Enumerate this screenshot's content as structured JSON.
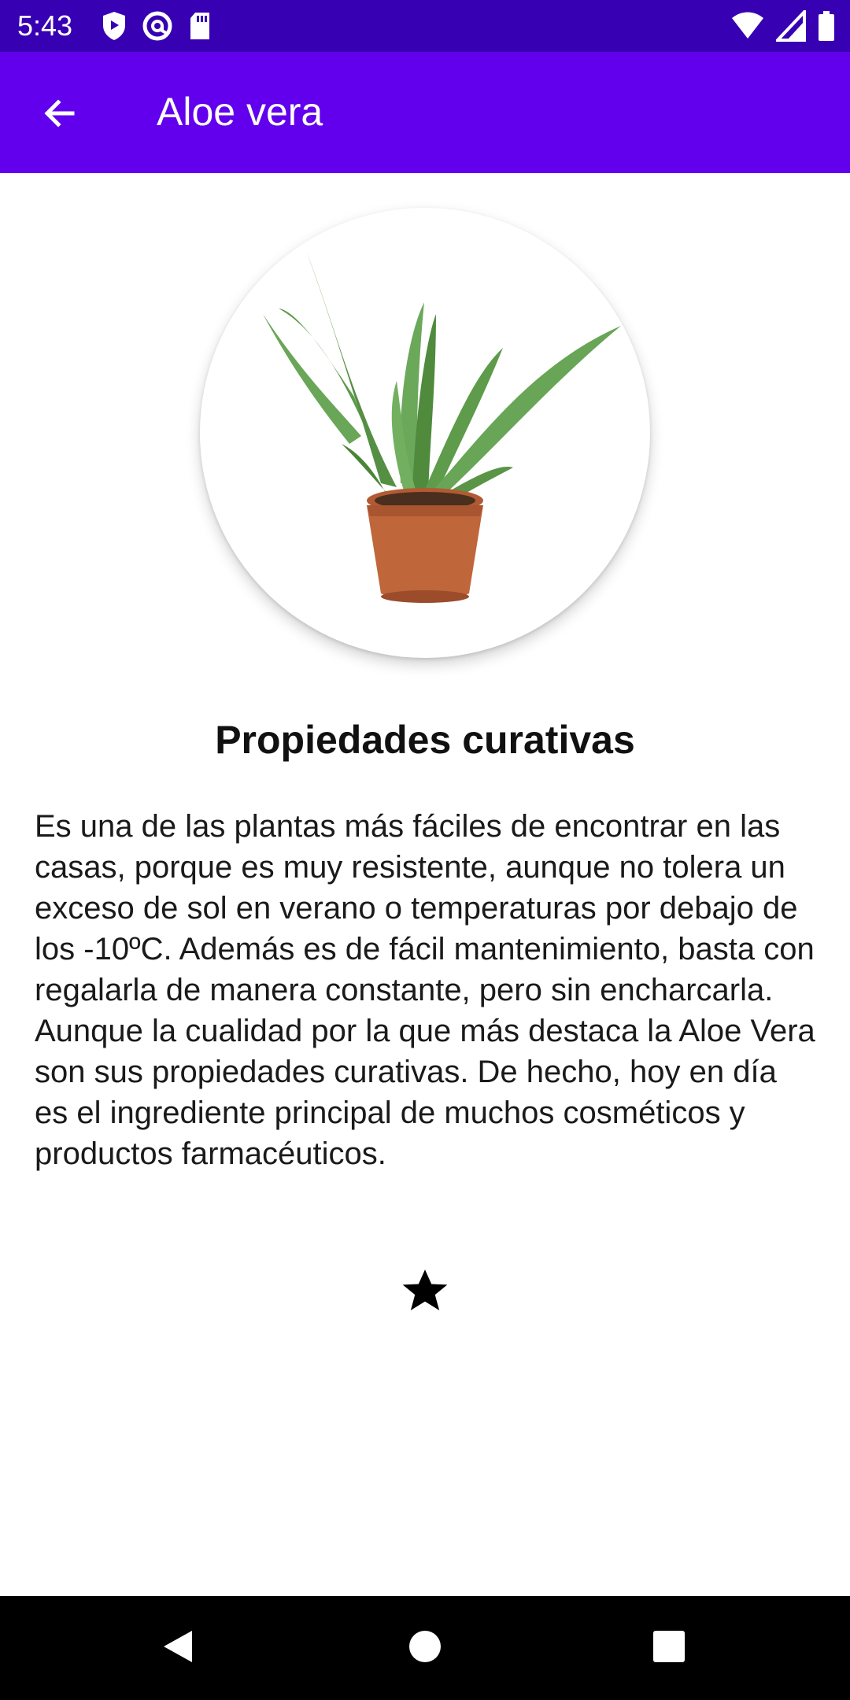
{
  "status_bar": {
    "time": "5:43",
    "left_icons": [
      "shield-icon",
      "at-sign-icon",
      "sd-card-icon"
    ],
    "right_icons": [
      "wifi-icon",
      "cell-signal-icon",
      "battery-icon"
    ]
  },
  "app_bar": {
    "title": "Aloe vera",
    "back_icon": "arrow-back-icon",
    "background": "#6200ee"
  },
  "plant_image": {
    "subject": "aloe vera plant in terracotta pot"
  },
  "content": {
    "section_title": "Propiedades curativas",
    "description": "Es una de las plantas más fáciles de encontrar en las casas, porque es muy resistente, aunque no tolera un exceso de sol en verano o temperaturas por debajo de los -10ºC. Además es de fácil mantenimiento, basta con regalarla de manera constante, pero sin encharcarla. Aunque la cualidad por la que más destaca la Aloe Vera son sus propiedades curativas. De hecho, hoy en día es el ingrediente principal de muchos cosméticos y productos farmacéuticos.",
    "favorite_icon": "star-icon"
  },
  "nav_bar": {
    "buttons": [
      "back-triangle-icon",
      "home-circle-icon",
      "recents-square-icon"
    ]
  },
  "colors": {
    "status_bar": "#3700b3",
    "app_bar": "#6200ee",
    "nav_bar": "#000000"
  }
}
